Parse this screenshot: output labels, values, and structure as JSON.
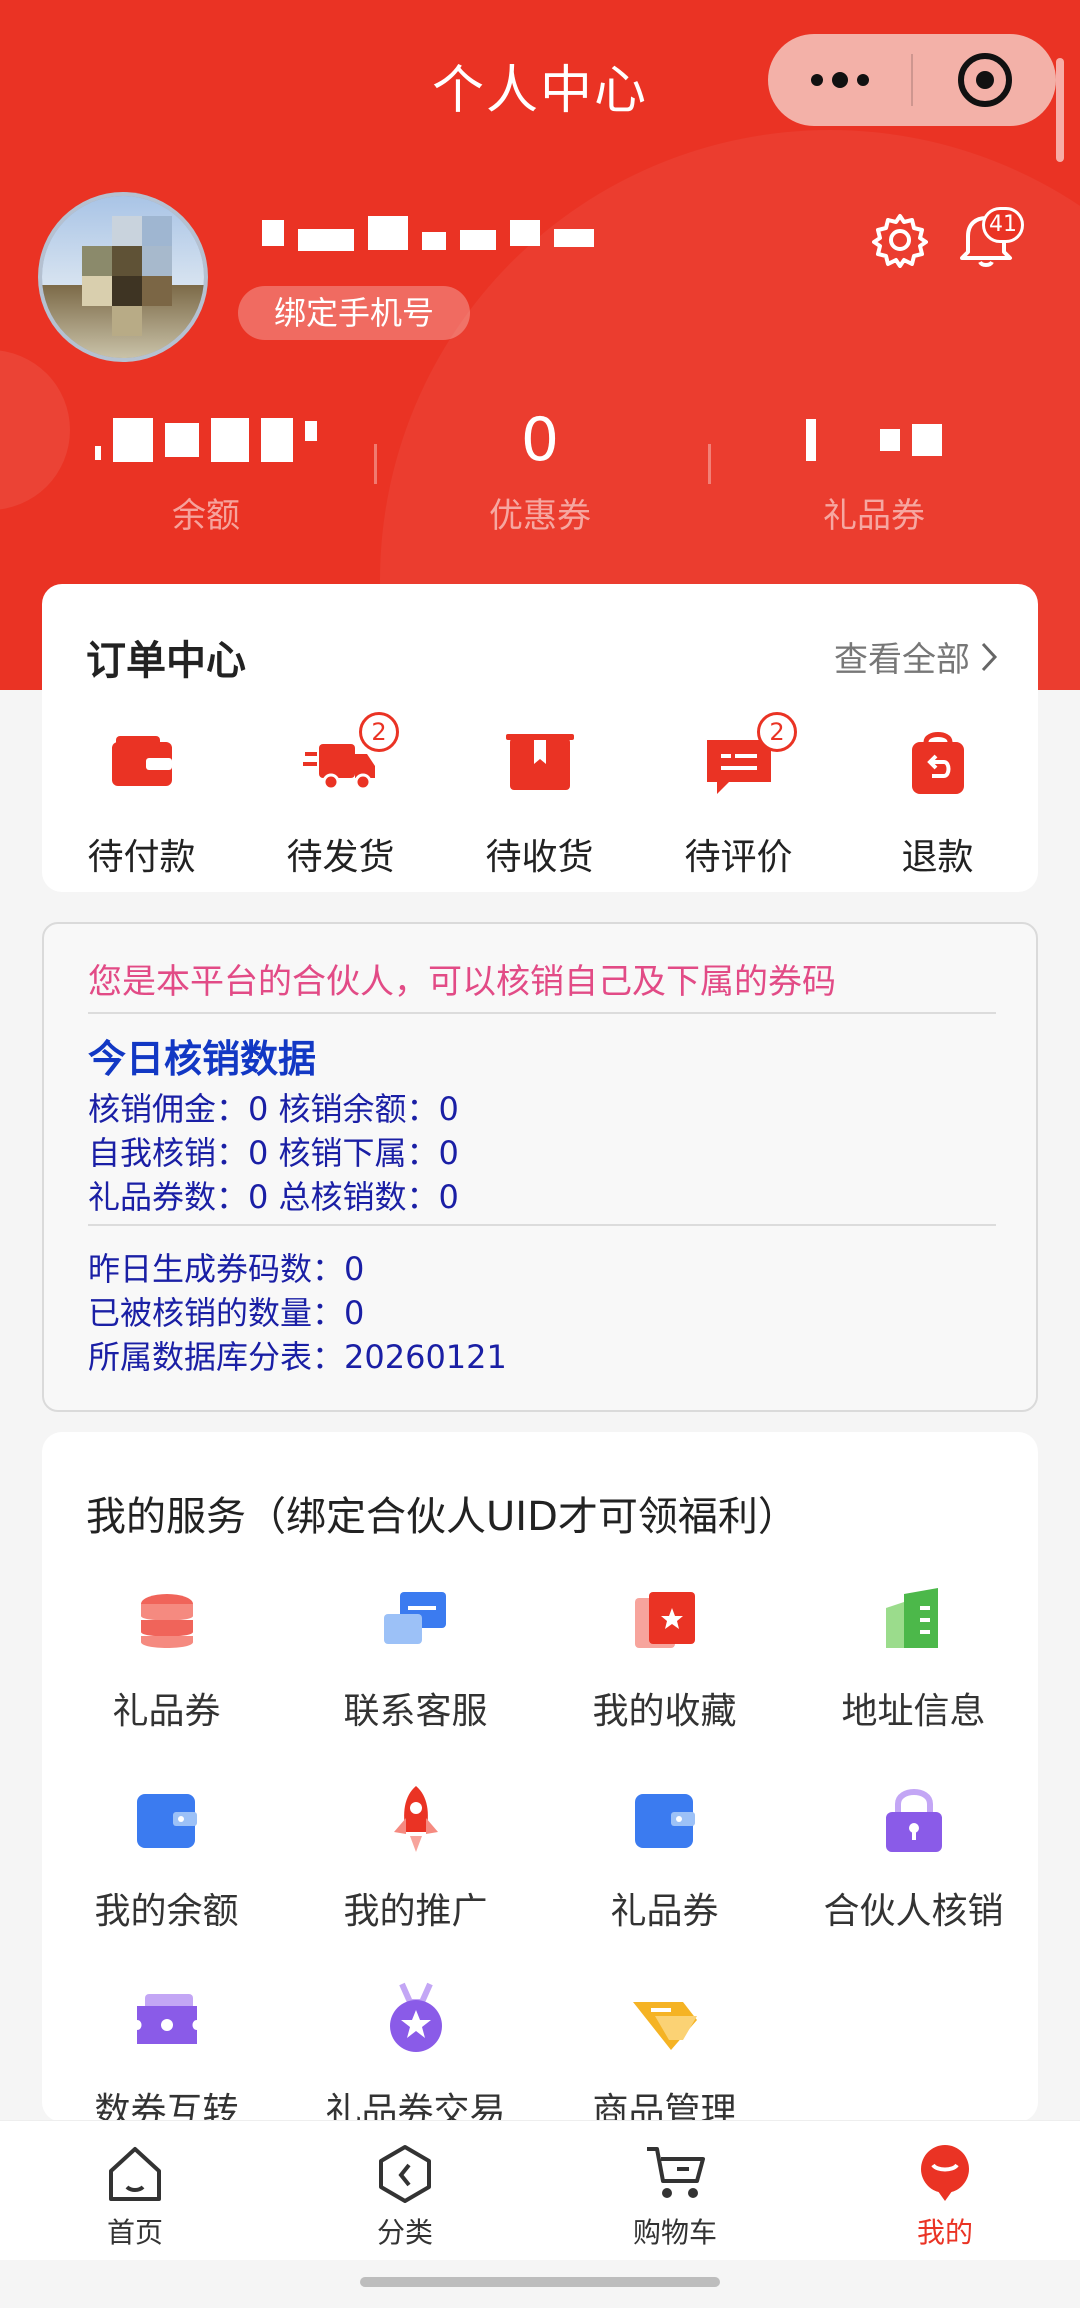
{
  "nav": {
    "title": "个人中心"
  },
  "profile": {
    "bind_phone": "绑定手机号",
    "notification_count": "41"
  },
  "stats": [
    {
      "label": "余额"
    },
    {
      "label": "优惠券",
      "value": "0"
    },
    {
      "label": "礼品券"
    }
  ],
  "orders": {
    "title": "订单中心",
    "view_all": "查看全部",
    "items": [
      {
        "label": "待付款",
        "icon": "wallet-icon"
      },
      {
        "label": "待发货",
        "icon": "truck-icon",
        "count": "2"
      },
      {
        "label": "待收货",
        "icon": "box-icon"
      },
      {
        "label": "待评价",
        "icon": "comment-icon",
        "count": "2"
      },
      {
        "label": "退款",
        "icon": "refund-icon"
      }
    ]
  },
  "partner": {
    "notice": "您是本平台的合伙人，可以核销自己及下属的券码",
    "today_title": "今日核销数据",
    "lines": [
      "核销佣金：0 核销余额：0",
      "自我核销：0 核销下属：0",
      "礼品券数：0 总核销数：0"
    ],
    "lines2": [
      "昨日生成券码数：0",
      "已被核销的数量：0",
      "所属数据库分表：20260121"
    ]
  },
  "services": {
    "title": "我的服务（绑定合伙人UID才可领福利）",
    "items": [
      {
        "label": "礼品券",
        "icon": "coin-stack-icon"
      },
      {
        "label": "联系客服",
        "icon": "chat-icon"
      },
      {
        "label": "我的收藏",
        "icon": "star-card-icon"
      },
      {
        "label": "地址信息",
        "icon": "document-icon"
      },
      {
        "label": "我的余额",
        "icon": "wallet-blue-icon"
      },
      {
        "label": "我的推广",
        "icon": "rocket-icon"
      },
      {
        "label": "礼品券",
        "icon": "wallet-blue-icon"
      },
      {
        "label": "合伙人核销",
        "icon": "lock-icon"
      },
      {
        "label": "数券互转",
        "icon": "ticket-icon"
      },
      {
        "label": "礼品券交易",
        "icon": "medal-icon"
      },
      {
        "label": "商品管理",
        "icon": "tag-icon"
      }
    ]
  },
  "tabbar": [
    {
      "label": "首页",
      "icon": "home-icon"
    },
    {
      "label": "分类",
      "icon": "category-icon"
    },
    {
      "label": "购物车",
      "icon": "cart-icon"
    },
    {
      "label": "我的",
      "icon": "profile-icon",
      "active": true
    }
  ],
  "colors": {
    "primary": "#ea3324",
    "partner_notice": "#e24b86",
    "partner_text": "#1a1fa5"
  }
}
